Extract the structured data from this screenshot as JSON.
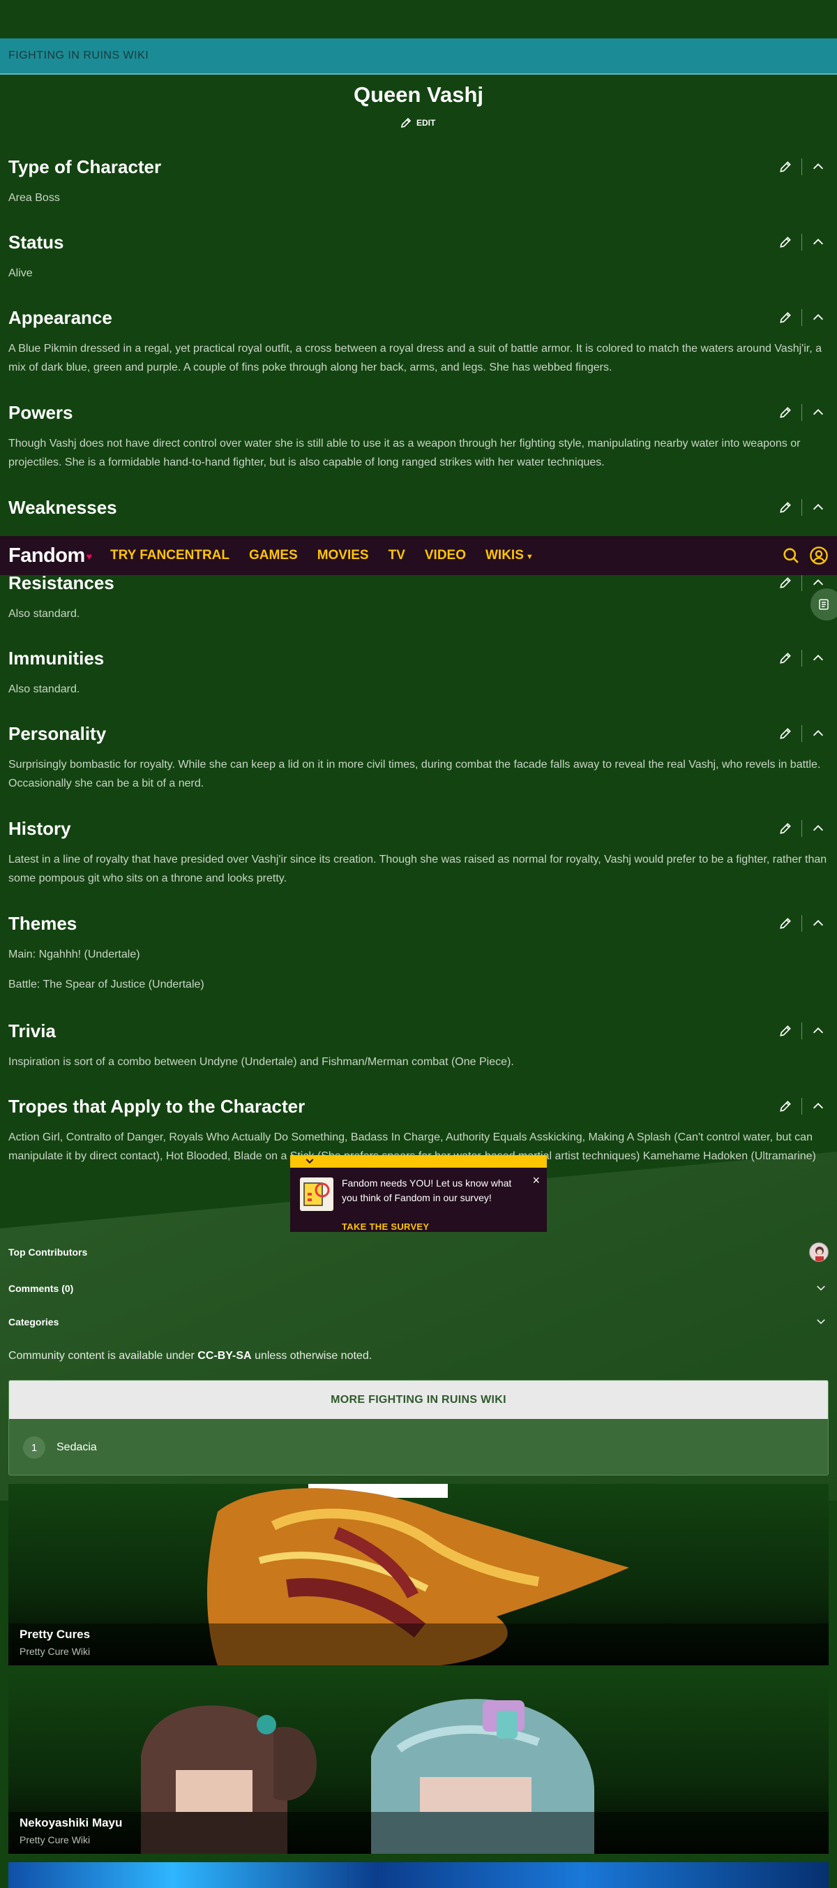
{
  "wiki_name": "FIGHTING IN RUINS WIKI",
  "page_title": "Queen Vashj",
  "edit_label": "EDIT",
  "sections": [
    {
      "title": "Type of Character",
      "body": [
        "Area Boss"
      ]
    },
    {
      "title": "Status",
      "body": [
        "Alive"
      ]
    },
    {
      "title": "Appearance",
      "body": [
        "A Blue Pikmin dressed in a regal, yet practical royal outfit, a cross between a royal dress and a suit of battle armor. It is colored to match the waters around Vashj'ir, a mix of dark blue, green and purple. A couple of fins poke through along her back, arms, and legs. She has webbed fingers."
      ]
    },
    {
      "title": "Powers",
      "body": [
        "Though Vashj does not have direct control over water she is still able to use it as a weapon through her fighting style, manipulating nearby water into weapons or projectiles. She is a formidable hand-to-hand fighter, but is also capable of long ranged strikes with her water techniques."
      ]
    },
    {
      "title": "Weaknesses",
      "body": []
    },
    {
      "title": "Resistances",
      "body": [
        "Also standard."
      ]
    },
    {
      "title": "Immunities",
      "body": [
        "Also standard."
      ]
    },
    {
      "title": "Personality",
      "body": [
        "Surprisingly bombastic for royalty. While she can keep a lid on it in more civil times, during combat the facade falls away to reveal the real Vashj, who revels in battle. Occasionally she can be a bit of a nerd."
      ]
    },
    {
      "title": "History",
      "body": [
        "Latest in a line of royalty that have presided over Vashj'ir since its creation. Though she was raised as normal for royalty, Vashj would prefer to be a fighter, rather than some pompous git who sits on a throne and looks pretty."
      ]
    },
    {
      "title": "Themes",
      "body": [
        "Main: Ngahhh! (Undertale)",
        "Battle: The Spear of Justice (Undertale)"
      ]
    },
    {
      "title": "Trivia",
      "body": [
        "Inspiration is sort of a combo between Undyne (Undertale) and Fishman/Merman combat (One Piece)."
      ]
    },
    {
      "title": "Tropes that Apply to the Character",
      "body": [
        "Action Girl, Contralto of Danger, Royals Who Actually Do Something, Badass In Charge, Authority Equals Asskicking, Making A Splash (Can't control water, but can manipulate it by direct contact), Hot Blooded, Blade on a Stick (She prefers spears for her water-based martial artist techniques) Kamehame Hadoken (Ultramarine)"
      ]
    }
  ],
  "nav": {
    "logo": "Fandom",
    "links": [
      "TRY FANCENTRAL",
      "GAMES",
      "MOVIES",
      "TV",
      "VIDEO",
      "WIKIS"
    ]
  },
  "survey": {
    "text": "Fandom needs YOU! Let us know what you think of Fandom in our survey!",
    "cta": "TAKE THE SURVEY",
    "close": "×"
  },
  "footer_meta": {
    "top_contributors": "Top Contributors",
    "comments": "Comments (0)",
    "categories": "Categories"
  },
  "license": {
    "prefix": "Community content is available under",
    "link": "CC-BY-SA",
    "suffix": "unless otherwise noted."
  },
  "more_wiki": {
    "title": "MORE FIGHTING IN RUINS WIKI",
    "items": [
      {
        "rank": "1",
        "name": "Sedacia"
      }
    ]
  },
  "cards": [
    {
      "title": "Pretty Cures",
      "subtitle": "Pretty Cure Wiki"
    },
    {
      "title": "Nekoyashiki Mayu",
      "subtitle": "Pretty Cure Wiki"
    }
  ],
  "colors": {
    "background": "#134311",
    "wiki_bar": "#1b8c96",
    "nav_bg": "#230d1e",
    "nav_link": "#ffc500",
    "survey_accent": "#ffc500"
  }
}
